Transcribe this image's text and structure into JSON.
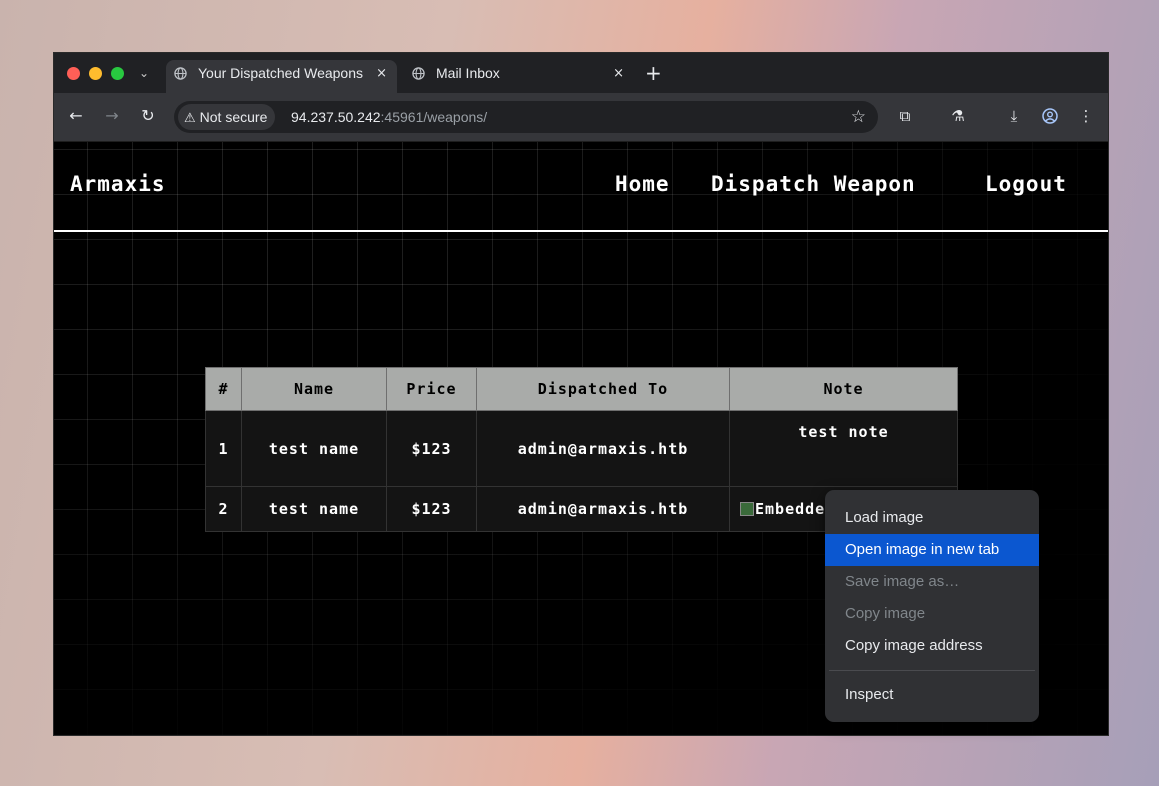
{
  "browser": {
    "tabs": [
      {
        "title": "Your Dispatched Weapons",
        "close": "×"
      },
      {
        "title": "Mail Inbox",
        "close": "×"
      }
    ],
    "new_tab": "+",
    "security_chip": "Not secure",
    "url_host": "94.237.50.242",
    "url_rest": ":45961/weapons/"
  },
  "site": {
    "brand": "Armaxis",
    "nav": [
      "Home",
      "Dispatch Weapon",
      "Logout"
    ]
  },
  "table": {
    "headers": [
      "#",
      "Name",
      "Price",
      "Dispatched To",
      "Note"
    ],
    "rows": [
      {
        "num": "1",
        "name": "test name",
        "price": "$123",
        "to": "admin@armaxis.htb",
        "note": "test note"
      },
      {
        "num": "2",
        "name": "test name",
        "price": "$123",
        "to": "admin@armaxis.htb",
        "note_alt": "Embedded"
      }
    ]
  },
  "context_menu": {
    "items": [
      "Load image",
      "Open image in new tab",
      "Save image as…",
      "Copy image",
      "Copy image address",
      "Inspect"
    ],
    "highlighted": "Open image in new tab",
    "disabled": [
      "Save image as…",
      "Copy image"
    ]
  },
  "colors": {
    "highlight": "#0b57d0",
    "table_header": "#a9aba9",
    "page_bg": "#000000"
  },
  "icons": [
    "globe-icon",
    "warning-icon",
    "star-icon",
    "back-icon",
    "forward-icon",
    "reload-icon",
    "extensions-icon",
    "labs-icon",
    "download-icon",
    "profile-icon",
    "menu-icon",
    "tab-search-icon"
  ]
}
